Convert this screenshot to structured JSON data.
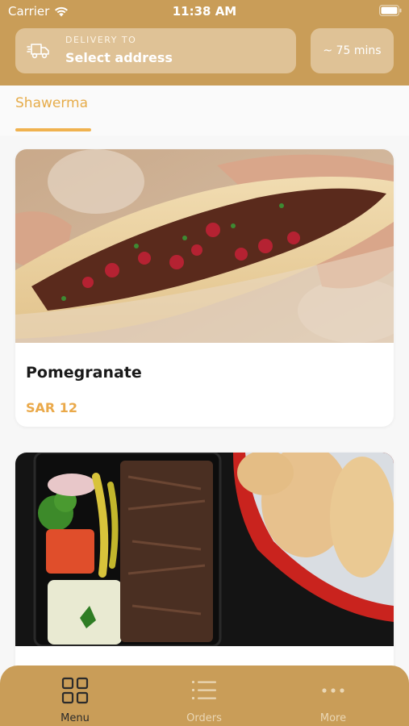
{
  "status_bar": {
    "carrier": "Carrier",
    "time": "11:38 AM"
  },
  "header": {
    "delivery_label": "DELIVERY TO",
    "delivery_address": "Select address",
    "eta": "~ 75 mins"
  },
  "category_tabs": {
    "active": "Shawerma"
  },
  "products": [
    {
      "name": "Pomegranate",
      "price": "SAR 12",
      "image": "shawarma-pita-with-pomegranate-photo"
    },
    {
      "name": "",
      "price": "",
      "image": "shawarma-meal-box-with-bread-photo"
    }
  ],
  "tabbar": {
    "items": [
      {
        "label": "Menu",
        "icon": "grid-icon",
        "active": true
      },
      {
        "label": "Orders",
        "icon": "list-icon",
        "active": false
      },
      {
        "label": "More",
        "icon": "more-dots-icon",
        "active": false
      }
    ]
  },
  "colors": {
    "brand": "#c99d58",
    "accent": "#eaa94a",
    "panel": "#dfc296"
  }
}
